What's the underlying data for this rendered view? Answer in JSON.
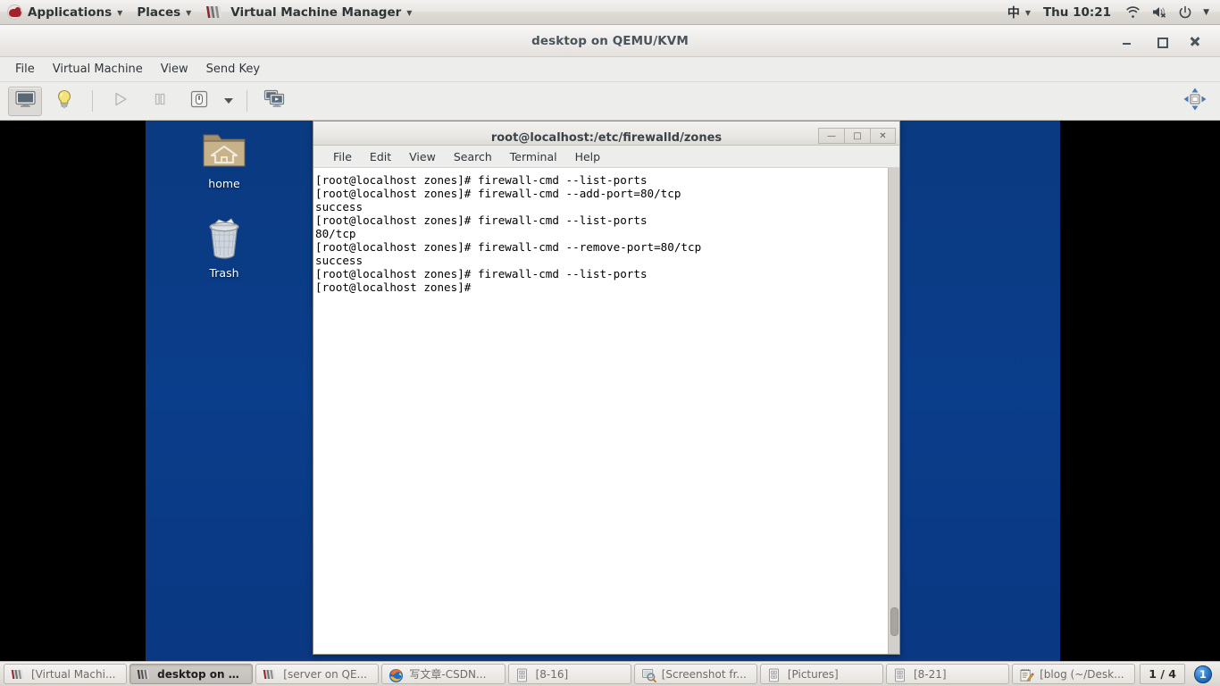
{
  "gnome_panel": {
    "menus": [
      {
        "label": "Applications",
        "icon": "redhat-logo-icon",
        "has_arrow": true
      },
      {
        "label": "Places",
        "icon": null,
        "has_arrow": true
      },
      {
        "label": "Virtual Machine Manager",
        "icon": "vmm-icon",
        "has_arrow": true
      }
    ],
    "ime_indicator": "中",
    "clock": "Thu 10:21",
    "tray": [
      "wifi-icon",
      "volume-muted-icon",
      "power-icon",
      "chevron-down-icon"
    ]
  },
  "vmm_window": {
    "title": "desktop on QEMU/KVM",
    "window_buttons": [
      "minimize-button",
      "maximize-button",
      "close-button"
    ],
    "menus": [
      "File",
      "Virtual Machine",
      "View",
      "Send Key"
    ],
    "toolbar": [
      {
        "name": "show-graphical-console",
        "icon": "monitor-icon",
        "state": "active"
      },
      {
        "name": "show-virtual-hardware-details",
        "icon": "lightbulb-icon",
        "state": "normal"
      },
      {
        "name": "run-vm",
        "icon": "play-icon",
        "state": "disabled"
      },
      {
        "name": "pause-vm",
        "icon": "pause-icon",
        "state": "disabled"
      },
      {
        "name": "shutdown-vm",
        "icon": "power-switch-icon",
        "state": "normal"
      },
      {
        "name": "shutdown-options-dropdown",
        "icon": "chevron-down-icon",
        "state": "normal"
      },
      {
        "name": "manage-snapshots",
        "icon": "snapshots-icon",
        "state": "normal"
      },
      {
        "name": "fullscreen-resize",
        "icon": "resize-arrows-icon",
        "state": "normal"
      }
    ]
  },
  "vm_desktop": {
    "background_color": "#0a3d8b",
    "icons": [
      {
        "label": "home",
        "icon": "home-folder-icon"
      },
      {
        "label": "Trash",
        "icon": "trash-can-icon"
      }
    ]
  },
  "terminal": {
    "title": "root@localhost:/etc/firewalld/zones",
    "window_buttons": [
      "minimize-button",
      "maximize-button",
      "close-button"
    ],
    "menus": [
      "File",
      "Edit",
      "View",
      "Search",
      "Terminal",
      "Help"
    ],
    "content": "[root@localhost zones]# firewall-cmd --list-ports\n[root@localhost zones]# firewall-cmd --add-port=80/tcp\nsuccess\n[root@localhost zones]# firewall-cmd --list-ports\n80/tcp\n[root@localhost zones]# firewall-cmd --remove-port=80/tcp\nsuccess\n[root@localhost zones]# firewall-cmd --list-ports\n[root@localhost zones]# "
  },
  "taskbar": {
    "tasks": [
      {
        "label": "[Virtual Machi...",
        "icon": "vmm-icon",
        "active": false
      },
      {
        "label": "desktop on Q...",
        "icon": "vmm-icon",
        "active": true
      },
      {
        "label": "[server on QE...",
        "icon": "vmm-icon",
        "active": false
      },
      {
        "label": "写文章-CSDN...",
        "icon": "firefox-icon",
        "active": false
      },
      {
        "label": "[8-16]",
        "icon": "file-manager-icon",
        "active": false
      },
      {
        "label": "[Screenshot fr...",
        "icon": "screenshot-icon",
        "active": false
      },
      {
        "label": "[Pictures]",
        "icon": "file-manager-icon",
        "active": false
      },
      {
        "label": "[8-21]",
        "icon": "file-manager-icon",
        "active": false
      },
      {
        "label": "[blog (~/Desk...",
        "icon": "text-editor-icon",
        "active": false
      }
    ],
    "workspace": "1 / 4",
    "notification_count": "1"
  }
}
